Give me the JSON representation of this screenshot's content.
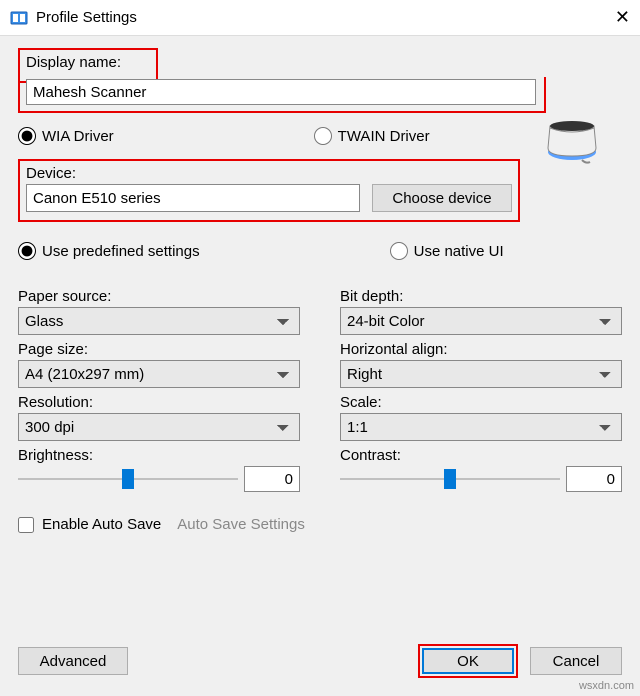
{
  "window": {
    "title": "Profile Settings",
    "close": "✕"
  },
  "display": {
    "label": "Display name:",
    "value": "Mahesh Scanner"
  },
  "driver": {
    "wia": "WIA Driver",
    "twain": "TWAIN Driver"
  },
  "device": {
    "label": "Device:",
    "value": "Canon E510 series",
    "choose": "Choose device"
  },
  "settings_mode": {
    "predefined": "Use predefined settings",
    "native": "Use native UI"
  },
  "left": {
    "paper_source_label": "Paper source:",
    "paper_source": "Glass",
    "page_size_label": "Page size:",
    "page_size": "A4 (210x297 mm)",
    "resolution_label": "Resolution:",
    "resolution": "300 dpi",
    "brightness_label": "Brightness:",
    "brightness": "0"
  },
  "right": {
    "bit_depth_label": "Bit depth:",
    "bit_depth": "24-bit Color",
    "halign_label": "Horizontal align:",
    "halign": "Right",
    "scale_label": "Scale:",
    "scale": "1:1",
    "contrast_label": "Contrast:",
    "contrast": "0"
  },
  "autosave": {
    "enable": "Enable Auto Save",
    "settings": "Auto Save Settings"
  },
  "buttons": {
    "advanced": "Advanced",
    "ok": "OK",
    "cancel": "Cancel"
  },
  "watermark": "wsxdn.com"
}
